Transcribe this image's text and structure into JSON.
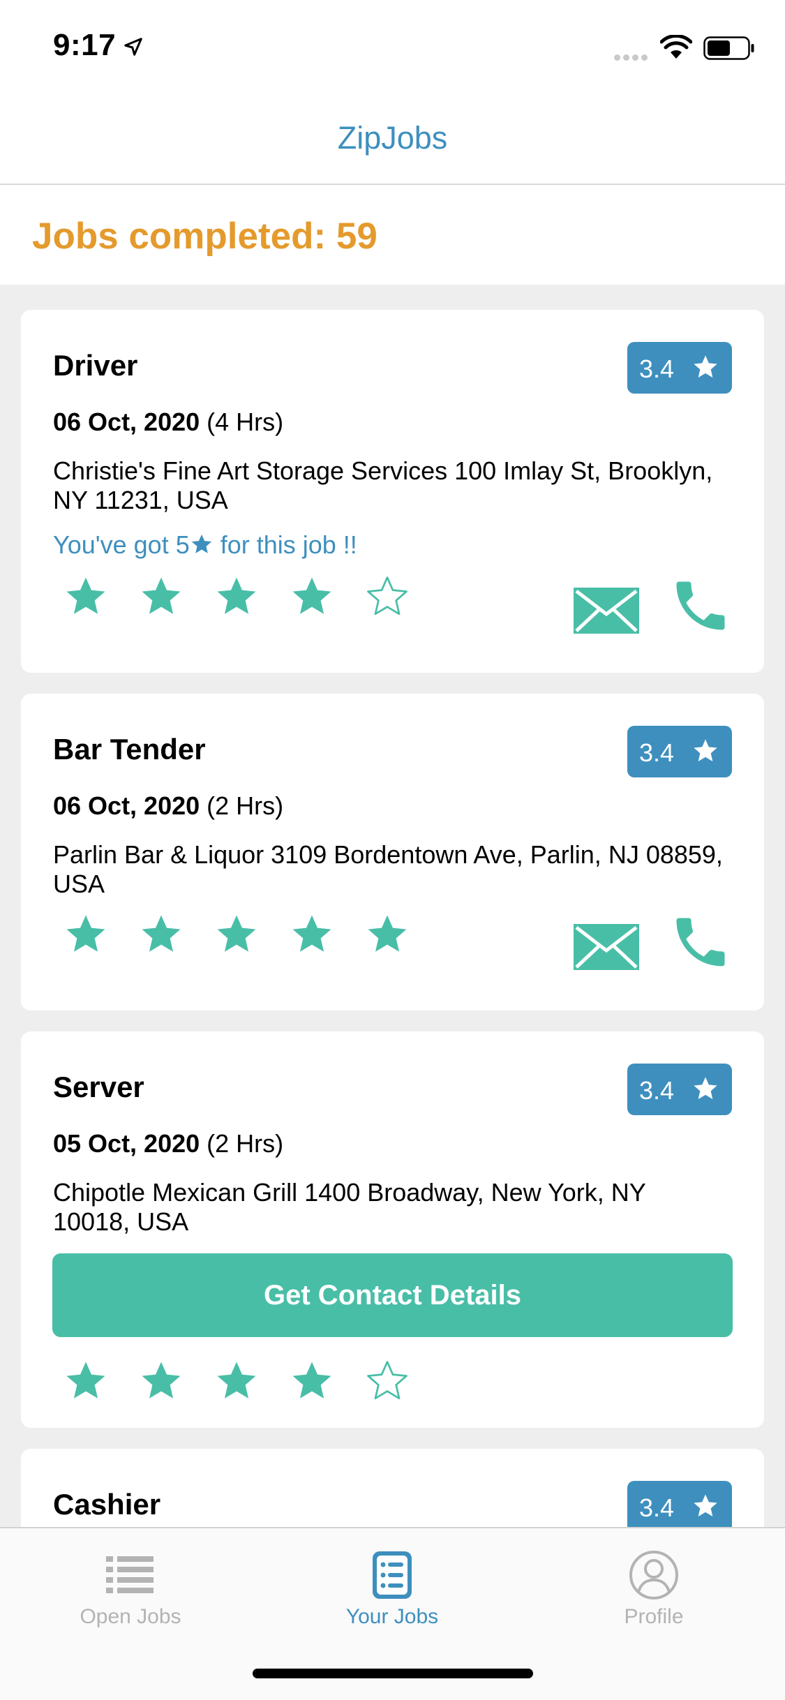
{
  "status_bar": {
    "time": "9:17"
  },
  "nav": {
    "title": "ZipJobs"
  },
  "header": {
    "jobs_completed": "Jobs completed: 59"
  },
  "colors": {
    "accent_blue": "#3e8fbe",
    "accent_green": "#49bea7",
    "accent_orange": "#e49a2c"
  },
  "jobs": [
    {
      "title": "Driver",
      "rating": "3.4",
      "date": "06 Oct, 2020",
      "duration": "(4 Hrs)",
      "address": "Christie's Fine Art Storage Services 100 Imlay St, Brooklyn, NY 11231, USA",
      "message_prefix": "You've got 5",
      "message_suffix": " for this job !!",
      "stars_filled": 4,
      "stars_total": 5,
      "contact_icons": [
        "mail-icon",
        "phone-icon"
      ]
    },
    {
      "title": "Bar Tender",
      "rating": "3.4",
      "date": "06 Oct, 2020",
      "duration": "(2 Hrs)",
      "address": "Parlin Bar & Liquor 3109 Bordentown Ave, Parlin, NJ 08859, USA",
      "stars_filled": 5,
      "stars_total": 5,
      "contact_icons": [
        "mail-icon",
        "phone-icon"
      ]
    },
    {
      "title": "Server",
      "rating": "3.4",
      "date": "05 Oct, 2020",
      "duration": "(2 Hrs)",
      "address": "Chipotle Mexican Grill 1400 Broadway, New York, NY 10018, USA",
      "button_label": "Get Contact Details",
      "stars_filled": 4,
      "stars_total": 5
    },
    {
      "title": "Cashier",
      "rating": "3.4"
    }
  ],
  "tabs": [
    {
      "label": "Open Jobs",
      "icon": "list-icon",
      "active": false
    },
    {
      "label": "Your Jobs",
      "icon": "jobs-list-icon",
      "active": true
    },
    {
      "label": "Profile",
      "icon": "profile-icon",
      "active": false
    }
  ]
}
